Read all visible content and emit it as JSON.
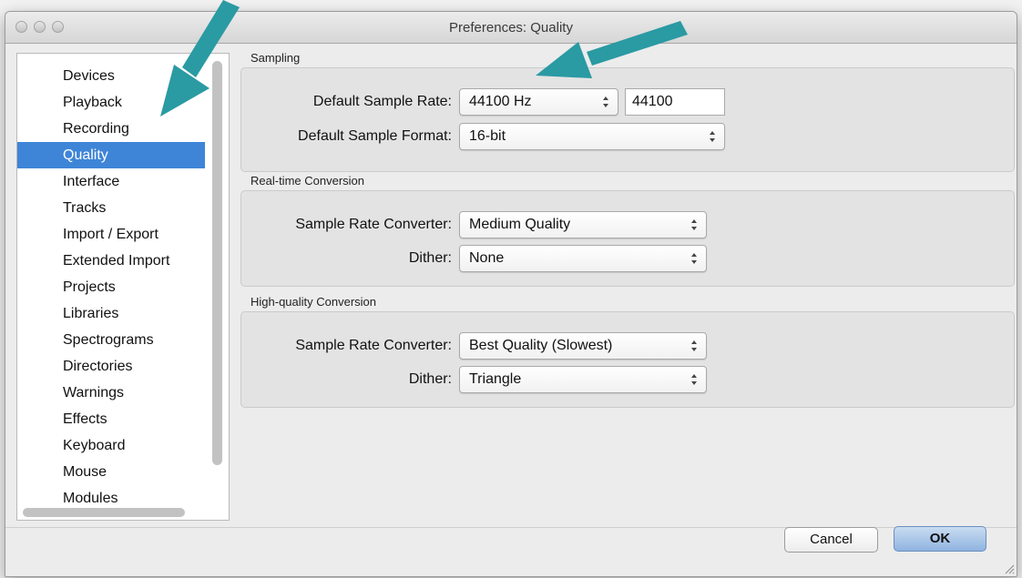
{
  "window": {
    "title": "Preferences: Quality"
  },
  "sidebar": {
    "items": [
      {
        "label": "Devices"
      },
      {
        "label": "Playback"
      },
      {
        "label": "Recording"
      },
      {
        "label": "Quality"
      },
      {
        "label": "Interface"
      },
      {
        "label": "Tracks"
      },
      {
        "label": "Import / Export"
      },
      {
        "label": "Extended Import"
      },
      {
        "label": "Projects"
      },
      {
        "label": "Libraries"
      },
      {
        "label": "Spectrograms"
      },
      {
        "label": "Directories"
      },
      {
        "label": "Warnings"
      },
      {
        "label": "Effects"
      },
      {
        "label": "Keyboard"
      },
      {
        "label": "Mouse"
      },
      {
        "label": "Modules"
      }
    ],
    "selected": "Quality"
  },
  "sampling": {
    "title": "Sampling",
    "rate_label": "Default Sample Rate:",
    "rate_value": "44100 Hz",
    "rate_text": "44100",
    "format_label": "Default Sample Format:",
    "format_value": "16-bit"
  },
  "realtime": {
    "title": "Real-time Conversion",
    "converter_label": "Sample Rate Converter:",
    "converter_value": "Medium Quality",
    "dither_label": "Dither:",
    "dither_value": "None"
  },
  "highquality": {
    "title": "High-quality Conversion",
    "converter_label": "Sample Rate Converter:",
    "converter_value": "Best Quality (Slowest)",
    "dither_label": "Dither:",
    "dither_value": "Triangle"
  },
  "buttons": {
    "cancel": "Cancel",
    "ok": "OK"
  },
  "colors": {
    "selection": "#3e85d8",
    "annotation_arrow": "#2a9aa3"
  }
}
